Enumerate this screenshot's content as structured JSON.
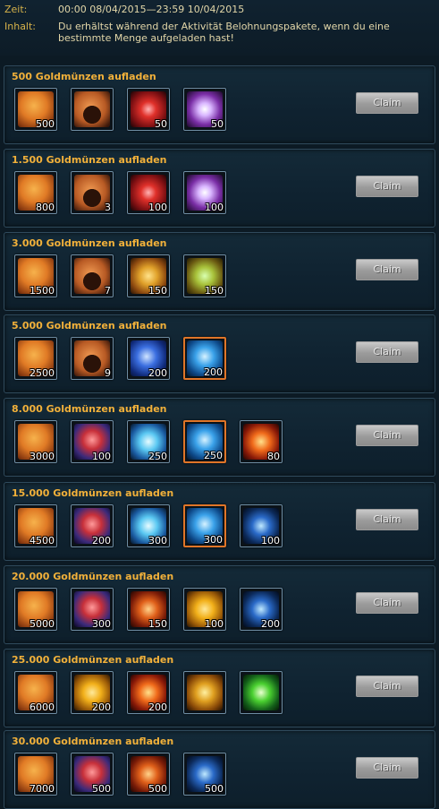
{
  "header": {
    "time_label": "Zeit:",
    "time_value": "00:00 08/04/2015—23:59 10/04/2015",
    "content_label": "Inhalt:",
    "content_value": "Du erhältst während der Aktivität Belohnungspakete, wenn du eine bestimmte Menge aufgeladen hast!"
  },
  "claim_label": "Claim",
  "tiers": [
    {
      "title": "500 Goldmünzen aufladen",
      "items": [
        {
          "icon": "gold-coin-pouch-icon",
          "qty": "500"
        },
        {
          "icon": "bread-icon",
          "qty": ""
        },
        {
          "icon": "red-gem-icon",
          "qty": "50"
        },
        {
          "icon": "feather-icon",
          "qty": "50"
        }
      ]
    },
    {
      "title": "1.500 Goldmünzen aufladen",
      "items": [
        {
          "icon": "gold-coin-pouch-icon",
          "qty": "800"
        },
        {
          "icon": "bread-icon",
          "qty": "3"
        },
        {
          "icon": "red-gem-icon",
          "qty": "100"
        },
        {
          "icon": "feather-icon",
          "qty": "100"
        }
      ]
    },
    {
      "title": "3.000 Goldmünzen aufladen",
      "items": [
        {
          "icon": "gold-coin-pouch-icon",
          "qty": "1500"
        },
        {
          "icon": "bread-icon",
          "qty": "7"
        },
        {
          "icon": "gold-rune-icon",
          "qty": "150"
        },
        {
          "icon": "green-rune-icon",
          "qty": "150"
        }
      ]
    },
    {
      "title": "5.000 Goldmünzen aufladen",
      "items": [
        {
          "icon": "gold-coin-pouch-icon",
          "qty": "2500"
        },
        {
          "icon": "bread-icon",
          "qty": "9"
        },
        {
          "icon": "blue-orb-icon",
          "qty": "200"
        },
        {
          "icon": "blue-gem-icon",
          "qty": "200"
        }
      ]
    },
    {
      "title": "8.000 Goldmünzen aufladen",
      "items": [
        {
          "icon": "gold-coin-pouch-icon",
          "qty": "3000"
        },
        {
          "icon": "red-sack-icon",
          "qty": "100"
        },
        {
          "icon": "crystal-icon",
          "qty": "250"
        },
        {
          "icon": "blue-gem-icon",
          "qty": "250"
        },
        {
          "icon": "fire-scroll-icon",
          "qty": "80"
        }
      ]
    },
    {
      "title": "15.000 Goldmünzen aufladen",
      "items": [
        {
          "icon": "gold-coin-pouch-icon",
          "qty": "4500"
        },
        {
          "icon": "red-sack-icon",
          "qty": "200"
        },
        {
          "icon": "crystal-icon",
          "qty": "300"
        },
        {
          "icon": "blue-gem-icon",
          "qty": "300"
        },
        {
          "icon": "dark-gem-icon",
          "qty": "100"
        }
      ]
    },
    {
      "title": "20.000 Goldmünzen aufladen",
      "items": [
        {
          "icon": "gold-coin-pouch-icon",
          "qty": "5000"
        },
        {
          "icon": "red-sack-icon",
          "qty": "300"
        },
        {
          "icon": "fire-egg-icon",
          "qty": "150"
        },
        {
          "icon": "gold-coin-icon",
          "qty": "100"
        },
        {
          "icon": "dark-gem-icon",
          "qty": "200"
        }
      ]
    },
    {
      "title": "25.000 Goldmünzen aufladen",
      "items": [
        {
          "icon": "gold-coin-pouch-icon",
          "qty": "6000"
        },
        {
          "icon": "gold-coin-icon",
          "qty": "200"
        },
        {
          "icon": "fire-scroll-icon",
          "qty": "200"
        },
        {
          "icon": "amber-gem-icon",
          "qty": ""
        },
        {
          "icon": "green-orb-icon",
          "qty": ""
        }
      ]
    },
    {
      "title": "30.000 Goldmünzen aufladen",
      "items": [
        {
          "icon": "gold-coin-pouch-icon",
          "qty": "7000"
        },
        {
          "icon": "red-sack-icon",
          "qty": "500"
        },
        {
          "icon": "fire-egg-icon",
          "qty": "500"
        },
        {
          "icon": "dark-gem-icon",
          "qty": "500"
        }
      ]
    }
  ]
}
